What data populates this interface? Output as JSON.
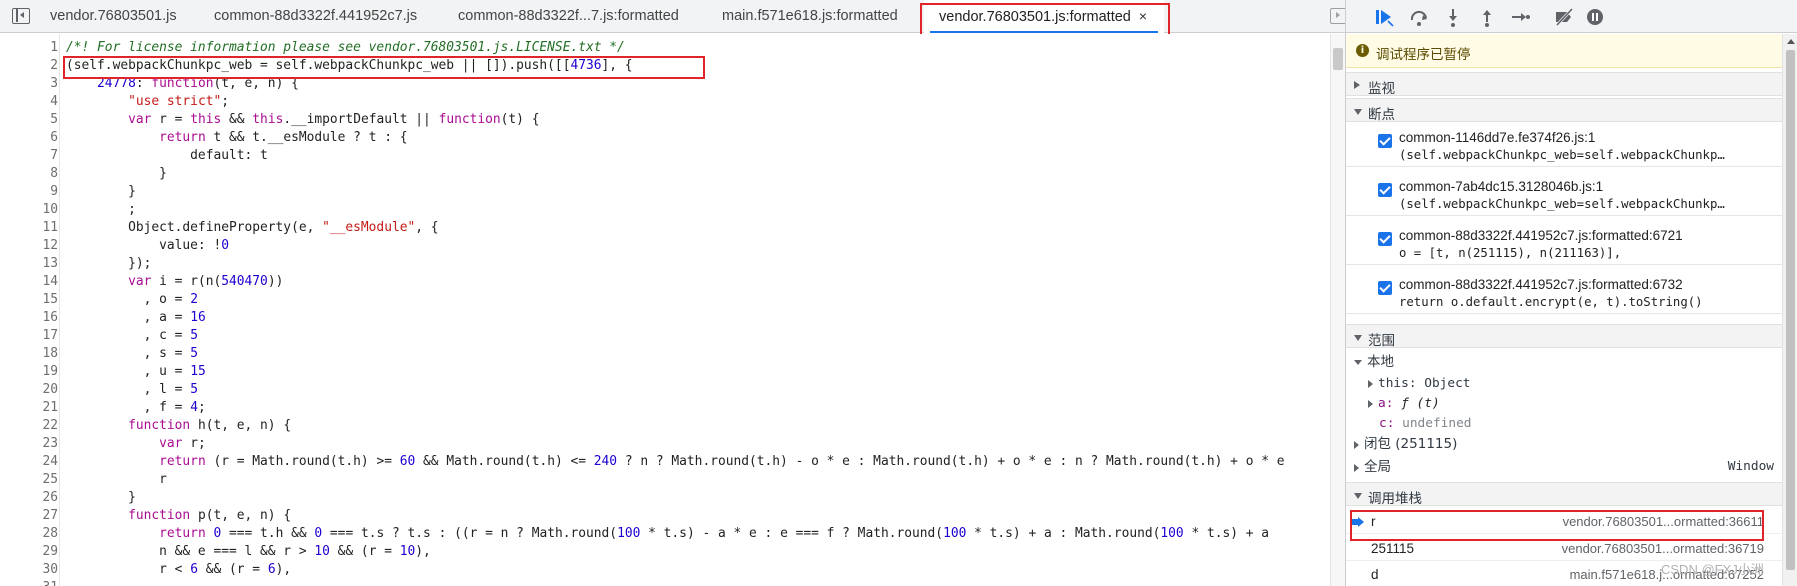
{
  "tabs": [
    {
      "label": "vendor.76803501.js",
      "active": false
    },
    {
      "label": "common-88d3322f.441952c7.js",
      "active": false
    },
    {
      "label": "common-88d3322f...7.js:formatted",
      "active": false
    },
    {
      "label": "main.f571e618.js:formatted",
      "active": false
    },
    {
      "label": "vendor.76803501.js:formatted",
      "active": true,
      "close": "×"
    }
  ],
  "code_lines": [
    {
      "n": "1",
      "html": "<span class=\"tk-com\">/*! For license information please see vendor.76803501.js.LICENSE.txt */</span>"
    },
    {
      "n": "2",
      "html": "(self.webpackChunkpc_web = self.webpackChunkpc_web || []).push([[<span class=\"tk-num\">4736</span>], {"
    },
    {
      "n": "3",
      "html": "    <span class=\"tk-num\">24778</span>: <span class=\"tk-kw\">function</span>(t, e, n) {"
    },
    {
      "n": "4",
      "html": "        <span class=\"tk-str\">\"use strict\"</span>;"
    },
    {
      "n": "5",
      "html": "        <span class=\"tk-kw\">var</span> r = <span class=\"tk-kw\">this</span> &amp;&amp; <span class=\"tk-kw\">this</span>.__importDefault || <span class=\"tk-kw\">function</span>(t) {"
    },
    {
      "n": "6",
      "html": "            <span class=\"tk-kw\">return</span> t &amp;&amp; t.__esModule ? t : {"
    },
    {
      "n": "7",
      "html": "                default: t"
    },
    {
      "n": "8",
      "html": "            }"
    },
    {
      "n": "9",
      "html": "        }"
    },
    {
      "n": "10",
      "html": "        ;"
    },
    {
      "n": "11",
      "html": "        Object.defineProperty(e, <span class=\"tk-str\">\"__esModule\"</span>, {"
    },
    {
      "n": "12",
      "html": "            value: !<span class=\"tk-num\">0</span>"
    },
    {
      "n": "13",
      "html": "        });"
    },
    {
      "n": "14",
      "html": "        <span class=\"tk-kw\">var</span> i = r(n(<span class=\"tk-num\">540470</span>))"
    },
    {
      "n": "15",
      "html": "          , o = <span class=\"tk-num\">2</span>"
    },
    {
      "n": "16",
      "html": "          , a = <span class=\"tk-num\">16</span>"
    },
    {
      "n": "17",
      "html": "          , c = <span class=\"tk-num\">5</span>"
    },
    {
      "n": "18",
      "html": "          , s = <span class=\"tk-num\">5</span>"
    },
    {
      "n": "19",
      "html": "          , u = <span class=\"tk-num\">15</span>"
    },
    {
      "n": "20",
      "html": "          , l = <span class=\"tk-num\">5</span>"
    },
    {
      "n": "21",
      "html": "          , f = <span class=\"tk-num\">4</span>;"
    },
    {
      "n": "22",
      "html": "        <span class=\"tk-kw\">function</span> h(t, e, n) {"
    },
    {
      "n": "23",
      "html": "            <span class=\"tk-kw\">var</span> r;"
    },
    {
      "n": "24",
      "html": "            <span class=\"tk-kw\">return</span> (r = Math.round(t.h) &gt;= <span class=\"tk-num\">60</span> &amp;&amp; Math.round(t.h) &lt;= <span class=\"tk-num\">240</span> ? n ? Math.round(t.h) - o * e : Math.round(t.h) + o * e : n ? Math.round(t.h) + o * e"
    },
    {
      "n": "25",
      "html": "            r"
    },
    {
      "n": "26",
      "html": "        }"
    },
    {
      "n": "27",
      "html": "        <span class=\"tk-kw\">function</span> p(t, e, n) {"
    },
    {
      "n": "28",
      "html": "            <span class=\"tk-kw\">return</span> <span class=\"tk-num\">0</span> === t.h &amp;&amp; <span class=\"tk-num\">0</span> === t.s ? t.s : ((r = n ? Math.round(<span class=\"tk-num\">100</span> * t.s) - a * e : e === f ? Math.round(<span class=\"tk-num\">100</span> * t.s) + a : Math.round(<span class=\"tk-num\">100</span> * t.s) + a"
    },
    {
      "n": "29",
      "html": "            n &amp;&amp; e === l &amp;&amp; r &gt; <span class=\"tk-num\">10</span> &amp;&amp; (r = <span class=\"tk-num\">10</span>),"
    },
    {
      "n": "30",
      "html": "            r &lt; <span class=\"tk-num\">6</span> &amp;&amp; (r = <span class=\"tk-num\">6</span>),"
    },
    {
      "n": "31",
      "html": "            ..."
    }
  ],
  "debugger": {
    "paused_msg": "调试程序已暂停",
    "info_icon": "i",
    "sections": {
      "watch": "监视",
      "breakpoints": "断点",
      "scope": "范围",
      "callstack": "调用堆栈"
    },
    "breakpoints": [
      {
        "loc": "common-1146dd7e.fe374f26.js:1",
        "snippet": "(self.webpackChunkpc_web=self.webpackChunkp…"
      },
      {
        "loc": "common-7ab4dc15.3128046b.js:1",
        "snippet": "(self.webpackChunkpc_web=self.webpackChunkp…"
      },
      {
        "loc": "common-88d3322f.441952c7.js:formatted:6721",
        "snippet": "o = [t, n(251115), n(211163)],"
      },
      {
        "loc": "common-88d3322f.441952c7.js:formatted:6732",
        "snippet": "return o.default.encrypt(e, t).toString()"
      }
    ],
    "scope": {
      "local": "本地",
      "this_name": "this:",
      "this_val": "Object",
      "a_name": "a:",
      "a_val": "ƒ (t)",
      "c_name": "c:",
      "c_val": "undefined",
      "closure": "闭包 (251115)",
      "global": "全局",
      "global_val": "Window"
    },
    "callstack": [
      {
        "name": "r",
        "loc": "vendor.76803501...ormatted:36611",
        "current": true
      },
      {
        "name": "251115",
        "loc": "vendor.76803501...ormatted:36719",
        "current": false
      },
      {
        "name": "d",
        "loc": "main.f571e618.j...ormatted:67252",
        "current": false
      }
    ]
  },
  "watermark": "CSDN @FXJ小洲",
  "colors": {
    "accent": "#1a73e8",
    "highlight": "#e0242a"
  }
}
